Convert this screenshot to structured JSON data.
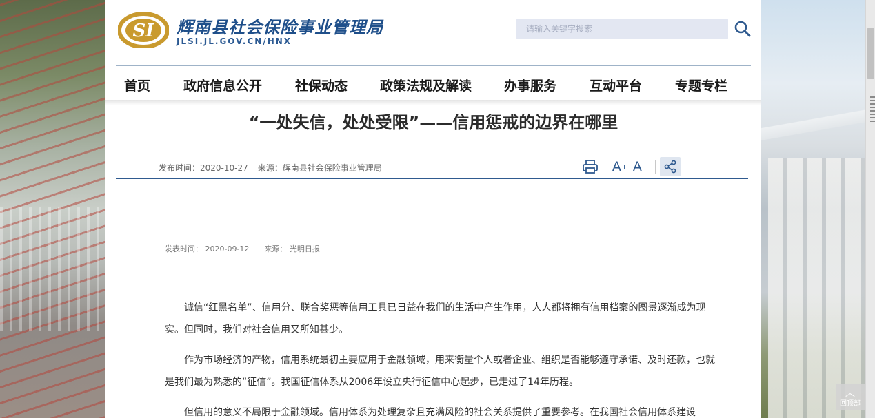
{
  "header": {
    "site_name": "辉南县社会保险事业管理局",
    "site_url": "JLSI.JL.GOV.CN/HNX",
    "logo_text": "SI",
    "search_placeholder": "请输入关键字搜索"
  },
  "nav": {
    "items": [
      {
        "label": "首页"
      },
      {
        "label": "政府信息公开"
      },
      {
        "label": "社保动态"
      },
      {
        "label": "政策法规及解读"
      },
      {
        "label": "办事服务"
      },
      {
        "label": "互动平台"
      },
      {
        "label": "专题专栏"
      }
    ]
  },
  "article": {
    "title": "“一处失信，处处受限”——信用惩戒的边界在哪里",
    "publish_time": "发布时间：2020-10-27",
    "source": "来源：辉南县社会保险事业管理局",
    "sub_publish_time": "发表时间： 2020-09-12",
    "sub_source": "来源： 光明日报",
    "paragraphs": [
      "诚信“红黑名单”、信用分、联合奖惩等信用工具已日益在我们的生活中产生作用，人人都将拥有信用档案的图景逐渐成为现实。但同时，我们对社会信用又所知甚少。",
      "作为市场经济的产物，信用系统最初主要应用于金融领域，用来衡量个人或者企业、组织是否能够遵守承诺、及时还款，也就是我们最为熟悉的“征信”。我国征信体系从2006年设立央行征信中心起步，已走过了14年历程。",
      "但信用的意义不局限于金融领域。信用体系为处理复杂且充满风险的社会关系提供了重要参考。在我国社会信用体系建设"
    ]
  },
  "tools": {
    "print_icon": "printer-icon",
    "font_increase": "A",
    "font_increase_mark": "+",
    "font_decrease": "A",
    "font_decrease_mark": "−",
    "share_icon": "share-icon"
  },
  "back_to_top": {
    "label": "回顶部"
  },
  "colors": {
    "brand_blue": "#1f4f8a",
    "logo_gold": "#c99a2e",
    "accent_rule": "#2f5a8f",
    "search_bg": "#e3e7f2"
  }
}
